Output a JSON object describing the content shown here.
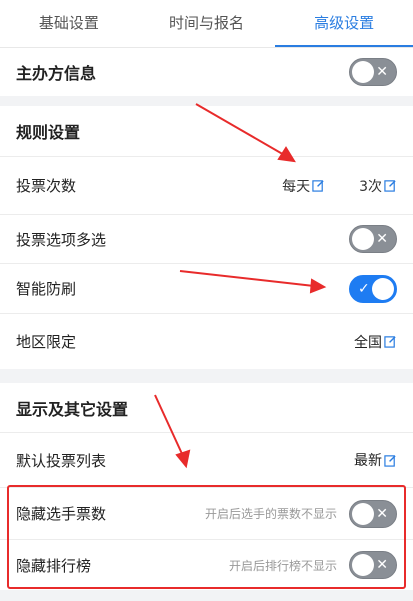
{
  "tabs": [
    "基础设置",
    "时间与报名",
    "高级设置"
  ],
  "active_tab": 2,
  "organizer": {
    "label": "主办方信息",
    "toggle": "off"
  },
  "rules": {
    "title": "规则设置",
    "vote_count": {
      "label": "投票次数",
      "period": "每天",
      "times": "3次"
    },
    "multi_select": {
      "label": "投票选项多选",
      "toggle": "off"
    },
    "anti_cheat": {
      "label": "智能防刷",
      "toggle": "on"
    },
    "region": {
      "label": "地区限定",
      "value": "全国"
    }
  },
  "display": {
    "title": "显示及其它设置",
    "default_list": {
      "label": "默认投票列表",
      "value": "最新"
    },
    "hide_votes": {
      "label": "隐藏选手票数",
      "hint": "开启后选手的票数不显示",
      "toggle": "off"
    },
    "hide_rank": {
      "label": "隐藏排行榜",
      "hint": "开启后排行榜不显示",
      "toggle": "off"
    }
  },
  "colors": {
    "accent": "#1e7cf2",
    "annotation": "#e82b2b"
  },
  "icons": {
    "edit": "edit-icon",
    "toggle_off": "x-mark",
    "toggle_on": "check-mark"
  }
}
